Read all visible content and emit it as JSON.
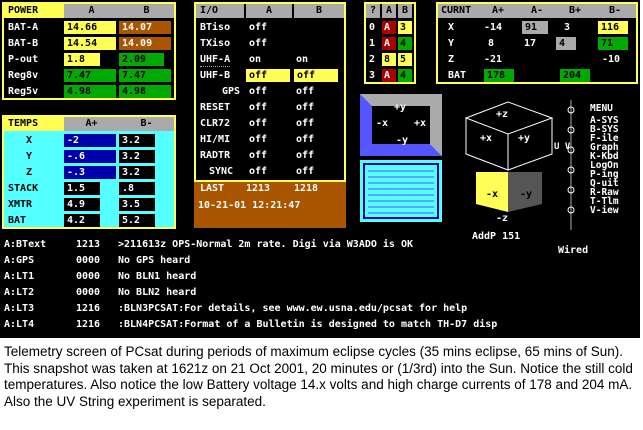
{
  "power": {
    "headers": [
      "POWER",
      "A",
      "B"
    ],
    "rows": [
      {
        "label": "BAT-A",
        "a": "14.66",
        "b": "14.07"
      },
      {
        "label": "BAT-B",
        "a": "14.54",
        "b": "14.09"
      },
      {
        "label": "P-out",
        "a": "1.8",
        "b": "2.09"
      },
      {
        "label": "Reg8v",
        "a": "7.47",
        "b": "7.47"
      },
      {
        "label": "Reg5v",
        "a": "4.98",
        "b": "4.98"
      }
    ]
  },
  "temps": {
    "headers": [
      "TEMPS",
      "A+",
      "B-"
    ],
    "rows": [
      {
        "label": "X",
        "a": "-2",
        "b": "3.2"
      },
      {
        "label": "Y",
        "a": "-.6",
        "b": "3.2"
      },
      {
        "label": "Z",
        "a": "-.3",
        "b": "3.2"
      },
      {
        "label": "STACK",
        "a": "1.5",
        "b": ".8"
      },
      {
        "label": "XMTR",
        "a": "4.9",
        "b": "3.5"
      },
      {
        "label": "BAT",
        "a": "4.2",
        "b": "5.2"
      }
    ]
  },
  "io": {
    "headers": [
      "I/O",
      "A",
      "B"
    ],
    "rows": [
      {
        "label": "BTiso",
        "a": "off",
        "b": ""
      },
      {
        "label": "TXiso",
        "a": "off",
        "b": ""
      },
      {
        "label": "UHF-A",
        "a": "on",
        "b": "on"
      },
      {
        "label": "UHF-B",
        "a": "off",
        "b": "off"
      },
      {
        "label": "GPS",
        "a": "off",
        "b": "off"
      },
      {
        "label": "RESET",
        "a": "off",
        "b": "off"
      },
      {
        "label": "CLR72",
        "a": "off",
        "b": "off"
      },
      {
        "label": "HI/MI",
        "a": "off",
        "b": "off"
      },
      {
        "label": "RADTR",
        "a": "off",
        "b": "off"
      },
      {
        "label": "SYNC",
        "a": "off",
        "b": "off"
      }
    ]
  },
  "last": {
    "label": "LAST",
    "a": "1213",
    "b": "1218",
    "datetime": "10-21-01 12:21:47"
  },
  "qab": {
    "headers": [
      "?",
      "A",
      "B"
    ],
    "rows": [
      {
        "q": "0",
        "a": "A",
        "b": "3"
      },
      {
        "q": "1",
        "a": "A",
        "b": "4"
      },
      {
        "q": "2",
        "a": "8",
        "b": "5"
      },
      {
        "q": "3",
        "a": "A",
        "b": "4"
      }
    ]
  },
  "current": {
    "headers": [
      "CURNT",
      "A+",
      "A-",
      "B+",
      "B-"
    ],
    "rows": [
      {
        "label": "X",
        "ap": "-14",
        "am": "91",
        "bp": "3",
        "bm": "116"
      },
      {
        "label": "Y",
        "ap": "8",
        "am": "17",
        "bp": "4",
        "bm": "71"
      },
      {
        "label": "Z",
        "ap": "-21",
        "am": "",
        "bp": "",
        "bm": "-10"
      }
    ],
    "bat": {
      "label": "BAT",
      "a": "178",
      "b": "204"
    }
  },
  "attitude": {
    "front": {
      "top": "+y",
      "left": "-x",
      "right": "+x",
      "bottom": "-y"
    },
    "cube": {
      "top": "+z",
      "left": "+x",
      "right": "+y",
      "bottom_left": "-x",
      "bottom_right": "-y",
      "bottom": "-z"
    },
    "uv": "U V",
    "addp": "AddP 151",
    "wired": "Wired"
  },
  "menu": {
    "title": "MENU",
    "items": [
      "A-SYS",
      "B-SYS",
      "F-ile",
      "Graph",
      "K-Kbd",
      "LogOn",
      "P-ing",
      "Q-uit",
      "R-Raw",
      "T-Tlm",
      "V-iew"
    ]
  },
  "log": [
    {
      "src": "A:BText",
      "num": "1213",
      "msg": ">211613z OPS-Normal 2m rate. Digi via W3ADO is OK"
    },
    {
      "src": "A:GPS",
      "num": "0000",
      "msg": "No GPS heard"
    },
    {
      "src": "A:LT1",
      "num": "0000",
      "msg": "No BLN1 heard"
    },
    {
      "src": "A:LT2",
      "num": "0000",
      "msg": "No BLN2 heard"
    },
    {
      "src": "A:LT3",
      "num": "1216",
      "msg": ":BLN3PCSAT:For details, see www.ew.usna.edu/pcsat for help"
    },
    {
      "src": "A:LT4",
      "num": "1216",
      "msg": ":BLN4PCSAT:Format of a Bulletin is designed to match TH-D7 disp"
    }
  ],
  "caption": "Telemetry screen of  PCsat  during periods of maximum eclipse cycles (35 mins eclipse, 65 mins of Sun).   This snapshot was taken at 1621z on 21 Oct 2001, 20 minutes or (1/3rd) into the  Sun.   Notice the still cold temperatures.   Also notice the  low Battery voltage 14.x  volts and high charge currents of 178 and 204 mA.   Also the UV String experiment is separated."
}
